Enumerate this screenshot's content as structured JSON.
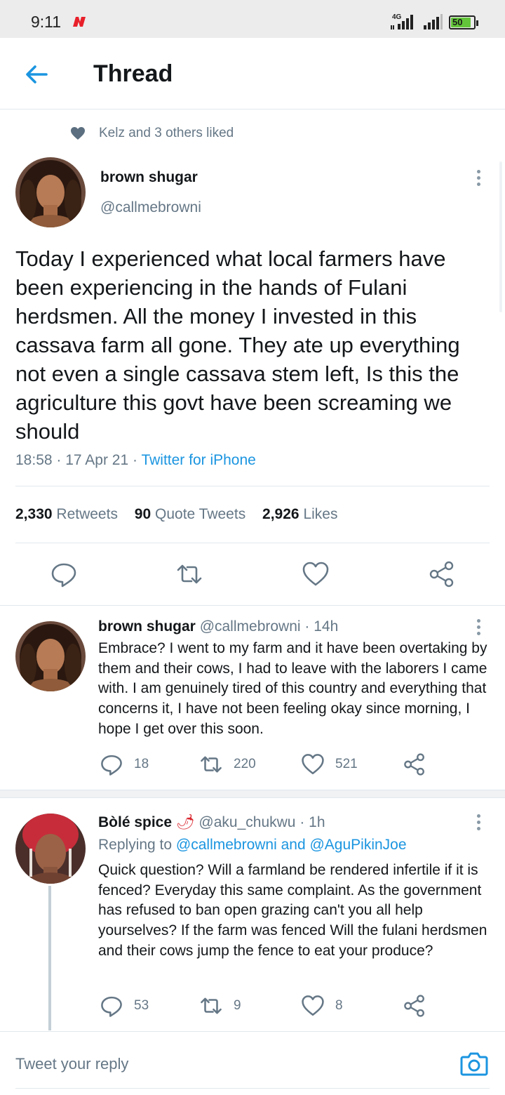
{
  "status_bar": {
    "time": "9:11",
    "network": "4G",
    "battery": "50",
    "battery_color": "#63c63a"
  },
  "header": {
    "back_icon": "arrow-left-icon",
    "title": "Thread"
  },
  "social_context": {
    "icon": "heart-icon",
    "text": "Kelz and 3 others liked"
  },
  "main_tweet": {
    "name": "brown shugar",
    "handle": "@callmebrowni",
    "text": "Today I experienced what local farmers have been experiencing in the hands of Fulani herdsmen. All the money I invested in this cassava farm all gone. They ate up everything not even a single cassava stem left, Is this the agriculture this govt have been screaming we should",
    "time": "18:58",
    "date": "17 Apr 21",
    "client": "Twitter for iPhone",
    "retweets_count": "2,330",
    "retweets_label": "Retweets",
    "quotes_count": "90",
    "quotes_label": "Quote Tweets",
    "likes_count": "2,926",
    "likes_label": "Likes"
  },
  "replies": [
    {
      "name": "brown shugar",
      "handle": "@callmebrowni",
      "age": "14h",
      "text": "Embrace? I went to my farm and it have been overtaking by them and their cows, I had to leave with the laborers I came with. I am genuinely tired of this country and everything that concerns it, I have not been feeling okay since morning, I hope I get over this soon.",
      "replies": "18",
      "retweets": "220",
      "likes": "521"
    },
    {
      "name": "Bòlé spice",
      "emoji": "🌶",
      "handle": "@aku_chukwu",
      "age": "1h",
      "replying_prefix": "Replying to",
      "replying_to": "@callmebrowni and @AguPikinJoe",
      "text": "Quick question? Will a farmland be rendered infertile if it is fenced? Everyday this same complaint. As the government has refused to ban open grazing can't you all help yourselves? If the farm was fenced Will the fulani herdsmen and their cows jump the fence to eat your produce?",
      "replies": "53",
      "retweets": "9",
      "likes": "8"
    }
  ],
  "composer": {
    "placeholder": "Tweet your reply",
    "camera_icon": "camera-icon"
  },
  "colors": {
    "accent": "#1b95e0",
    "muted": "#657786",
    "text": "#14171a",
    "divider": "#e1e8ed"
  }
}
